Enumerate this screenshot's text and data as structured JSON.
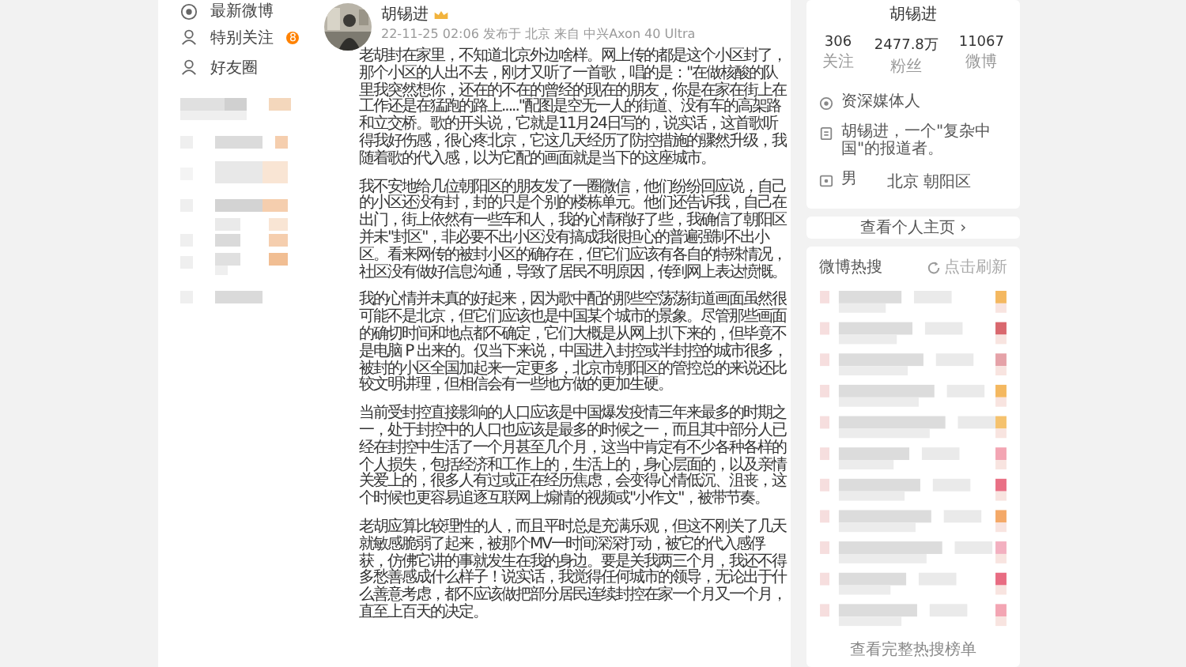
{
  "nav": [
    {
      "label": "最新微博"
    },
    {
      "label": "特别关注",
      "badge": "8"
    },
    {
      "label": "好友圈"
    }
  ],
  "post": {
    "author": "胡锡进",
    "meta": "22-11-25 02:06 发布于 北京 来自 中兴Axon 40 Ultra",
    "paragraphs": [
      "老胡封在家里，不知道北京外边啥样。网上传的都是这个小区封了，那个小区的人出不去，刚才又听了一首歌，唱的是：\"在做核酸的队里我突然想你，还在的不在的曾经的现在的朋友，你是在家在街上在工作还是在猛跑的路上.....\"配图是空无一人的街道、没有车的高架路和立交桥。歌的开头说，它就是11月24日写的，说实话，这首歌听得我好伤感，很心疼北京，它这几天经历了防控措施的骤然升级，我随着歌的代入感，以为它配的画面就是当下的这座城市。",
      "我不安地给几位朝阳区的朋友发了一圈微信，他们纷纷回应说，自己的小区还没有封，封的只是个别的楼栋单元。他们还告诉我，自己在出门，街上依然有一些车和人，我的心情稍好了些，我确信了朝阳区并未\"封区\"，非必要不出小区没有搞成我很担心的普遍强制不出小区。看来网传的被封小区的确存在，但它们应该有各自的特殊情况，社区没有做好信息沟通，导致了居民不明原因，传到网上表达愤慨。",
      "我的心情并未真的好起来，因为歌中配的那些空荡荡街道画面虽然很可能不是北京，但它们应该也是中国某个城市的景象。尽管那些画面的确切时间和地点都不确定，它们大概是从网上扒下来的，但毕竟不是电脑 P 出来的。仅当下来说，中国进入封控或半封控的城市很多，被封的小区全国加起来一定更多，北京市朝阳区的管控总的来说还比较文明讲理，但相信会有一些地方做的更加生硬。",
      "当前受封控直接影响的人口应该是中国爆发疫情三年来最多的时期之一，处于封控中的人口也应该是最多的时候之一，而且其中部分人已经在封控中生活了一个月甚至几个月，这当中肯定有不少各种各样的个人损失，包括经济和工作上的，生活上的，身心层面的，以及亲情关爱上的，很多人有过或正在经历焦虑，会变得心情低沉、沮丧，这个时候也更容易追逐互联网上煽情的视频或\"小作文\"，被带节奏。",
      "老胡应算比较理性的人，而且平时总是充满乐观，但这不刚关了几天就敏感脆弱了起来，被那个MV一时间深深打动，被它的代入感俘获，仿佛它讲的事就发生在我的身边。要是关我两三个月，我还不得多愁善感成什么样子！说实话，我觉得任何城市的领导，无论出于什么善意考虑，都不应该做把部分居民连续封控在家一个月又一个月，直至上百天的决定。"
    ]
  },
  "profile": {
    "name": "胡锡进",
    "stats": [
      {
        "value": "306",
        "label": "关注"
      },
      {
        "value": "2477.8万",
        "label": "粉丝"
      },
      {
        "value": "11067",
        "label": "微博"
      }
    ],
    "info": [
      {
        "text": "资深媒体人"
      },
      {
        "text": "胡锡进，一个\"复杂中国\"的报道者。"
      },
      {
        "text": "男",
        "extra": "北京 朝阳区"
      }
    ],
    "homepage_link": "查看个人主页",
    "chevron": "›"
  },
  "hot": {
    "title": "微博热搜",
    "refresh": "点击刷新",
    "footer": "查看完整热搜榜单"
  }
}
